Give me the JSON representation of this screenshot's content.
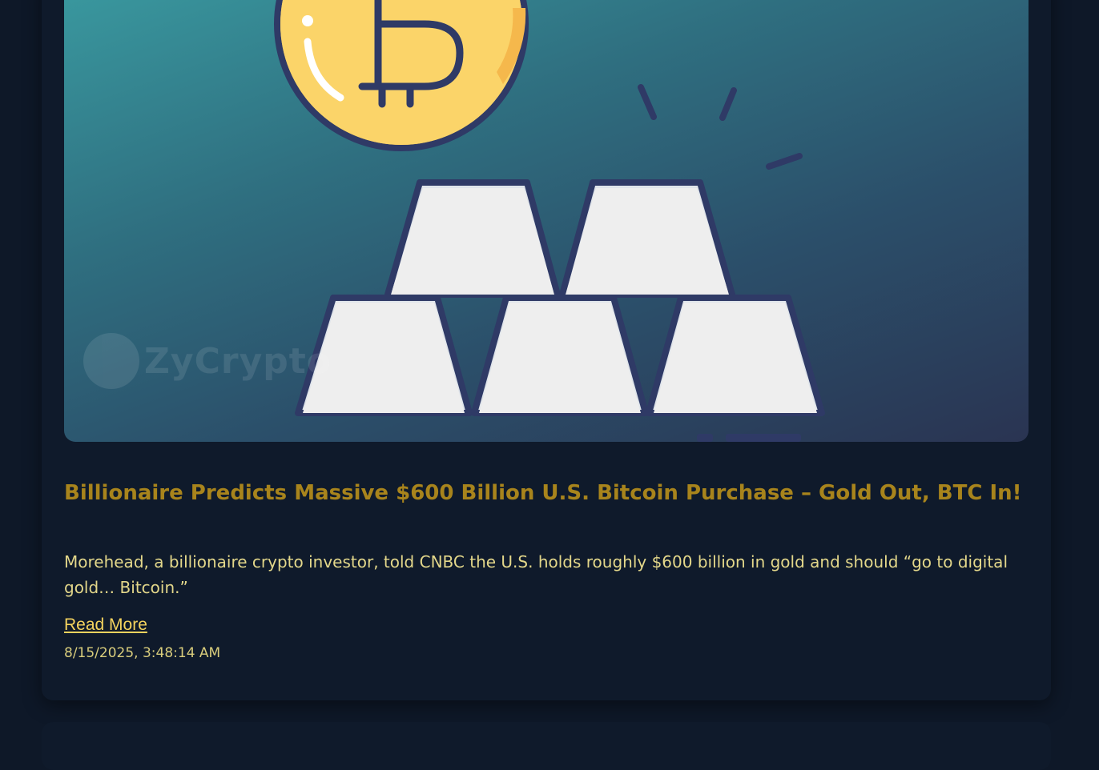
{
  "article": {
    "title": "Billionaire Predicts Massive $600 Billion U.S. Bitcoin Purchase – Gold Out, BTC In!",
    "summary": "Morehead, a billionaire crypto investor, told CNBC the U.S. holds roughly $600 billion in gold and should “go to digital gold… Bitcoin.”",
    "read_more_label": "Read More",
    "date": "8/15/2025, 3:48:14 AM",
    "image_watermark": "ZyCrypto"
  },
  "colors": {
    "title": "#a8841c",
    "summary": "#e3d78a",
    "link": "#f4d35e",
    "card_bg": "#0f1a2b",
    "page_bg": "#0e1828"
  },
  "icons": {
    "hero": "bitcoin-coin-and-gold-bars-illustration"
  }
}
